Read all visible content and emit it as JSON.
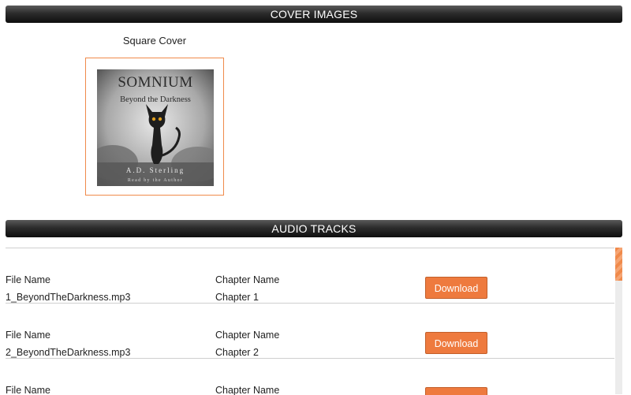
{
  "sections": {
    "cover_title": "COVER IMAGES",
    "audio_title": "AUDIO TRACKS"
  },
  "cover": {
    "label": "Square Cover",
    "art": {
      "title": "SOMNIUM",
      "subtitle": "Beyond the Darkness",
      "author": "A.D. Sterling",
      "narrator": "Read by the Author"
    }
  },
  "tracks": [
    {
      "file_label": "File Name",
      "file": "1_BeyondTheDarkness.mp3",
      "chapter_label": "Chapter Name",
      "chapter": "Chapter 1",
      "button": "Download"
    },
    {
      "file_label": "File Name",
      "file": "2_BeyondTheDarkness.mp3",
      "chapter_label": "Chapter Name",
      "chapter": "Chapter 2",
      "button": "Download"
    },
    {
      "file_label": "File Name",
      "file": "",
      "chapter_label": "Chapter Name",
      "chapter": "",
      "button": ""
    }
  ],
  "colors": {
    "accent": "#ee7a3e",
    "bar_dark": "#1a1a1a"
  }
}
